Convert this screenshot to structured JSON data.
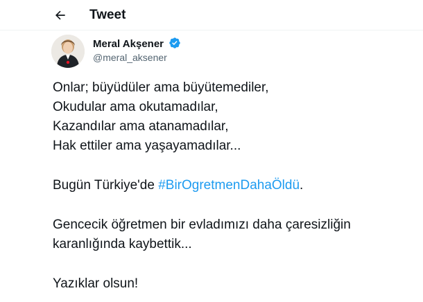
{
  "header": {
    "title": "Tweet",
    "back_icon": "arrow-left-icon"
  },
  "author": {
    "name": "Meral Akşener",
    "handle": "@meral_aksener",
    "verified_icon": "verified-badge-icon",
    "verified_color": "#1d9bf0"
  },
  "tweet": {
    "line1": "Onlar; büyüdüler ama büyütemediler,",
    "line2": "Okudular ama okutamadılar,",
    "line3": "Kazandılar ama atanamadılar,",
    "line4": "Hak ettiler ama yaşayamadılar...",
    "line5_prefix": "Bugün Türkiye'de ",
    "hashtag": "#BirOgretmenDahaÖldü",
    "line5_suffix": ".",
    "line6": "Gencecik öğretmen bir evladımızı daha çaresizliğin",
    "line7": "karanlığında kaybettik...",
    "line8": "Yazıklar olsun!"
  },
  "colors": {
    "text": "#0f1419",
    "secondary": "#536471",
    "accent": "#1d9bf0"
  }
}
